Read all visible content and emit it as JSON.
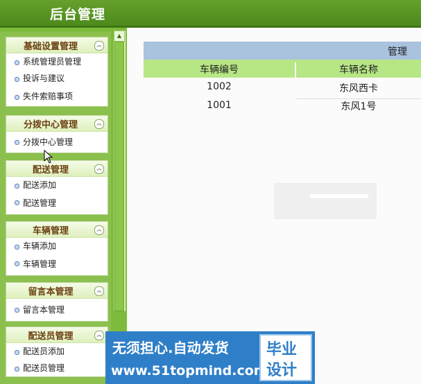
{
  "header": {
    "title": "后台管理"
  },
  "sidebar": {
    "groups": [
      {
        "title": "基础设置管理",
        "items": [
          "系统管理员管理",
          "投诉与建议",
          "失件索赔事项"
        ]
      },
      {
        "title": "分拨中心管理",
        "items": [
          "分拨中心管理"
        ]
      },
      {
        "title": "配送管理",
        "items": [
          "配送添加",
          "配送管理"
        ]
      },
      {
        "title": "车辆管理",
        "items": [
          "车辆添加",
          "车辆管理"
        ]
      },
      {
        "title": "留言本管理",
        "items": [
          "留言本管理"
        ]
      },
      {
        "title": "配送员管理",
        "items": [
          "配送员添加",
          "配送员管理"
        ]
      }
    ],
    "toggle_icon": "collapse-icon",
    "scroll_up_glyph": "▲"
  },
  "main": {
    "caption": "管理",
    "columns": [
      "车辆编号",
      "车辆名称"
    ],
    "rows": [
      [
        "1002",
        "东风西卡"
      ],
      [
        "1001",
        "东风1号"
      ]
    ]
  },
  "banner": {
    "line1": "无须担心.自动发货",
    "line2": "www.51topmind.com",
    "right1": "毕业",
    "right2": "设计"
  }
}
